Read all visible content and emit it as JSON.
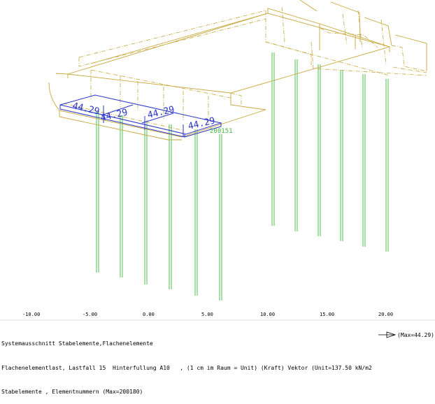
{
  "structure": {
    "colors": {
      "frame": "#c8a63a",
      "piles": "#4cc24c",
      "load": "#2a35c8",
      "element_label": "#3cb83c"
    }
  },
  "loads": {
    "labels": [
      "44.29",
      "44.29",
      "44.29",
      "44.29"
    ]
  },
  "element": {
    "number": "200151"
  },
  "scale": {
    "ticks": [
      "-10.00",
      "-5.00",
      "0.00",
      "5.00",
      "10.00",
      "15.00",
      "20.00"
    ]
  },
  "footer": {
    "line1": "Systemausschnitt Stabelemente,Flachenelemente",
    "line2_left": "Flachenelementlast, Lastfall 15  Hinterfullung A10   , (1 cm im Raum = Unit) (Kraft) Vektor (Unit=137.50 kN/m2",
    "line2_right": "(Max=44.29)",
    "line3": "Stabelemente , Elementnummern (Max=200180)"
  }
}
